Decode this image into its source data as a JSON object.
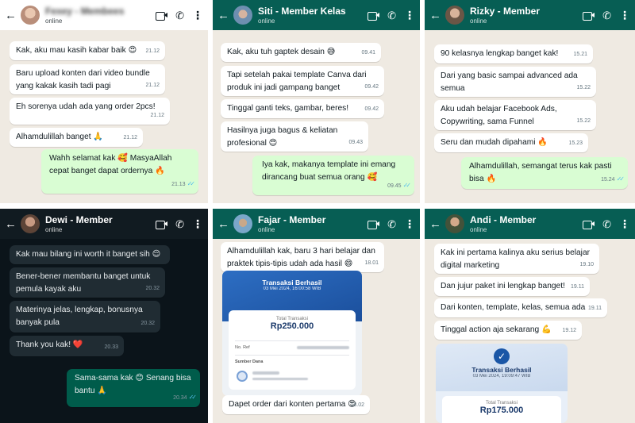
{
  "panels": [
    {
      "name": "Fexey - Membees",
      "status": "online",
      "messages": [
        {
          "text": "Kak, aku mau kasih kabar baik 😍",
          "time": "21.12"
        },
        {
          "text": "Baru upload konten dari video bundle yang kakak kasih tadi pagi",
          "time": "21.12"
        },
        {
          "text": "Eh sorenya udah ada yang order 2pcs!",
          "time": "21.12"
        },
        {
          "text": "Alhamdulillah banget 🙏",
          "time": "21.12"
        },
        {
          "text": "Wahh selamat kak 🥰 MasyaAllah cepat banget dapat ordernya 🔥",
          "time": "21.13"
        }
      ]
    },
    {
      "name": "Siti - Member Kelas",
      "status": "online",
      "messages": [
        {
          "text": "Kak, aku tuh gaptek desain 😅",
          "time": "09.41"
        },
        {
          "text": "Tapi setelah pakai template Canva dari produk ini jadi gampang banget",
          "time": "09.42"
        },
        {
          "text": "Tinggal ganti teks, gambar, beres!",
          "time": "09.42"
        },
        {
          "text": "Hasilnya juga bagus & keliatan profesional 😍",
          "time": "09.43"
        },
        {
          "text": "Iya kak, makanya template ini emang dirancang buat semua orang 🥰",
          "time": "09.45"
        }
      ]
    },
    {
      "name": "Rizky - Member",
      "status": "online",
      "messages": [
        {
          "text": "90 kelasnya lengkap banget kak!",
          "time": "15.21"
        },
        {
          "text": "Dari yang basic sampai advanced ada semua",
          "time": "15.22"
        },
        {
          "text": "Aku udah belajar Facebook Ads, Copywriting, sama Funnel",
          "time": "15.22"
        },
        {
          "text": "Seru dan mudah dipahami 🔥",
          "time": "15.23"
        },
        {
          "text": "Alhamdulillah, semangat terus kak pasti bisa 🔥",
          "time": "15.24"
        }
      ]
    },
    {
      "name": "Dewi - Member",
      "status": "online",
      "messages": [
        {
          "text": "Kak mau bilang ini worth it banget sih 😌",
          "time": ""
        },
        {
          "text": "Bener-bener membantu banget untuk pemula kayak aku",
          "time": "20.32"
        },
        {
          "text": "Materinya jelas, lengkap, bonusnya banyak pula",
          "time": "20.32"
        },
        {
          "text": "Thank you kak! ❤️",
          "time": "20.33"
        },
        {
          "text": "Sama-sama kak 😊 Senang bisa bantu 🙏",
          "time": "20.34"
        }
      ]
    },
    {
      "name": "Fajar - Member",
      "status": "online",
      "messages": [
        {
          "text": "Alhamdulillah kak, baru 3 hari belajar dan praktek tipis-tipis udah ada hasil 😄",
          "time": "18.01"
        },
        {
          "text": "Dapet order dari konten pertama 😍",
          "time": "18.02"
        }
      ],
      "receipt": {
        "title": "Transaksi Berhasil",
        "date": "03 Mei 2024, 16:00:58 WIB",
        "total_label": "Total Transaksi",
        "amount": "Rp250.000",
        "ref_label": "No. Ref",
        "source_label": "Sumber Dana"
      }
    },
    {
      "name": "Andi - Member",
      "status": "online",
      "messages": [
        {
          "text": "Kak ini pertama kalinya aku serius belajar digital marketing",
          "time": "19.10"
        },
        {
          "text": "Dan jujur paket ini lengkap banget!",
          "time": "19.11"
        },
        {
          "text": "Dari konten, template, kelas, semua ada",
          "time": "19.11"
        },
        {
          "text": "Tinggal action aja sekarang 💪",
          "time": "19.12"
        }
      ],
      "receipt": {
        "title": "Transaksi Berhasil",
        "date": "03 Mei 2024, 19:09:47 WIB",
        "total_label": "Total Transaksi",
        "amount": "Rp175.000"
      }
    }
  ],
  "icons": {
    "back": "back-arrow-icon",
    "video": "video-call-icon",
    "call": "phone-icon",
    "menu": "more-vertical-icon",
    "read": "double-check-icon"
  },
  "colors": {
    "wa_green_header": "#075e54",
    "chat_bg_light": "#efeae2",
    "chat_bg_dark": "#0b141a",
    "bubble_out_light": "#d9fdd3",
    "bubble_out_dark": "#005c4b",
    "read_ticks": "#53bdeb",
    "receipt_blue": "#1a56a6"
  }
}
